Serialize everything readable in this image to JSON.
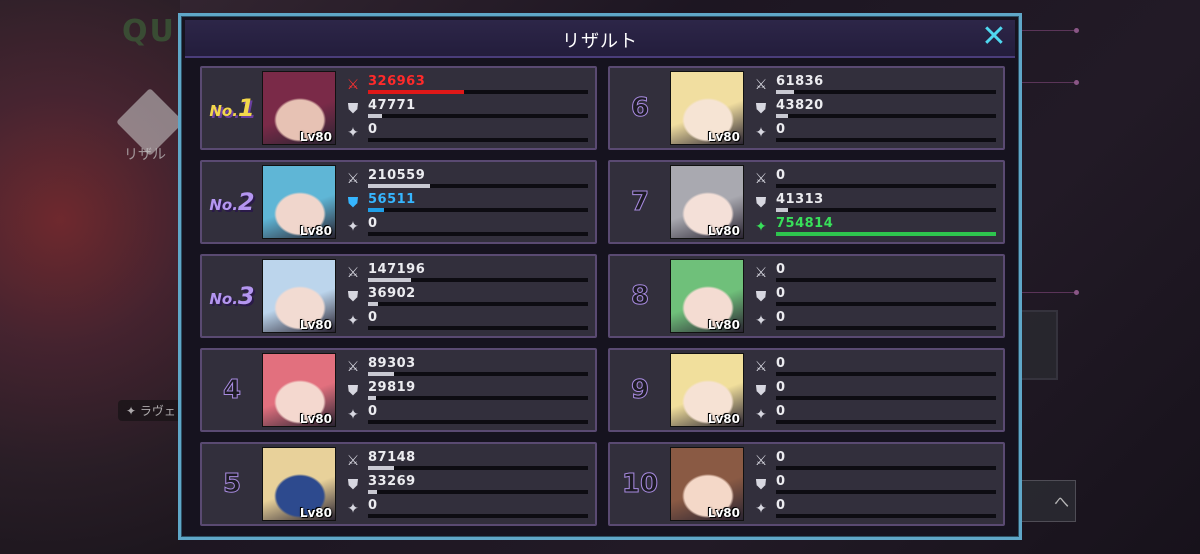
{
  "background": {
    "quest_title": "QU",
    "result_label": "リザル",
    "chip_label": "✦ ラヴェリ",
    "next_label": "へ"
  },
  "modal": {
    "title": "リザルト",
    "close_icon": "close-icon"
  },
  "icons": {
    "attack": "sword-icon",
    "defense": "shield-icon",
    "heal": "sparkle-icon"
  },
  "colors": {
    "frame": "#5fa7c8",
    "attack_highlight": "#e01818",
    "defense_highlight": "#1f9fe8",
    "heal_highlight": "#2ec44e"
  },
  "max": {
    "attack": 326963,
    "defense": 56511,
    "heal": 754814
  },
  "players": [
    {
      "rank": "1",
      "rank_prefix": "No.",
      "level": "Lv80",
      "attack": "326963",
      "defense": "47771",
      "heal": "0",
      "highlight": "attack",
      "portrait": [
        "#7a2a48",
        "#e7c2b4"
      ]
    },
    {
      "rank": "2",
      "rank_prefix": "No.",
      "level": "Lv80",
      "attack": "210559",
      "defense": "56511",
      "heal": "0",
      "highlight": "defense",
      "portrait": [
        "#5fb6d6",
        "#f0d6cc"
      ]
    },
    {
      "rank": "3",
      "rank_prefix": "No.",
      "level": "Lv80",
      "attack": "147196",
      "defense": "36902",
      "heal": "0",
      "highlight": "",
      "portrait": [
        "#bcd5ec",
        "#f2dbd2"
      ]
    },
    {
      "rank": "4",
      "rank_prefix": "",
      "level": "Lv80",
      "attack": "89303",
      "defense": "29819",
      "heal": "0",
      "highlight": "",
      "portrait": [
        "#e2707e",
        "#f4d8cf"
      ]
    },
    {
      "rank": "5",
      "rank_prefix": "",
      "level": "Lv80",
      "attack": "87148",
      "defense": "33269",
      "heal": "0",
      "highlight": "",
      "portrait": [
        "#e8d19a",
        "#2d4a8e"
      ]
    },
    {
      "rank": "6",
      "rank_prefix": "",
      "level": "Lv80",
      "attack": "61836",
      "defense": "43820",
      "heal": "0",
      "highlight": "",
      "portrait": [
        "#f1dea0",
        "#f6e4d4"
      ]
    },
    {
      "rank": "7",
      "rank_prefix": "",
      "level": "Lv80",
      "attack": "0",
      "defense": "41313",
      "heal": "754814",
      "highlight": "heal",
      "portrait": [
        "#a9a9b0",
        "#f4e0d8"
      ]
    },
    {
      "rank": "8",
      "rank_prefix": "",
      "level": "Lv80",
      "attack": "0",
      "defense": "0",
      "heal": "0",
      "highlight": "",
      "portrait": [
        "#6fc07a",
        "#f4dcd2"
      ]
    },
    {
      "rank": "9",
      "rank_prefix": "",
      "level": "Lv80",
      "attack": "0",
      "defense": "0",
      "heal": "0",
      "highlight": "",
      "portrait": [
        "#f1df9c",
        "#f6e2d4"
      ]
    },
    {
      "rank": "10",
      "rank_prefix": "",
      "level": "Lv80",
      "attack": "0",
      "defense": "0",
      "heal": "0",
      "highlight": "",
      "portrait": [
        "#8a5a44",
        "#f4d8c8"
      ]
    }
  ]
}
